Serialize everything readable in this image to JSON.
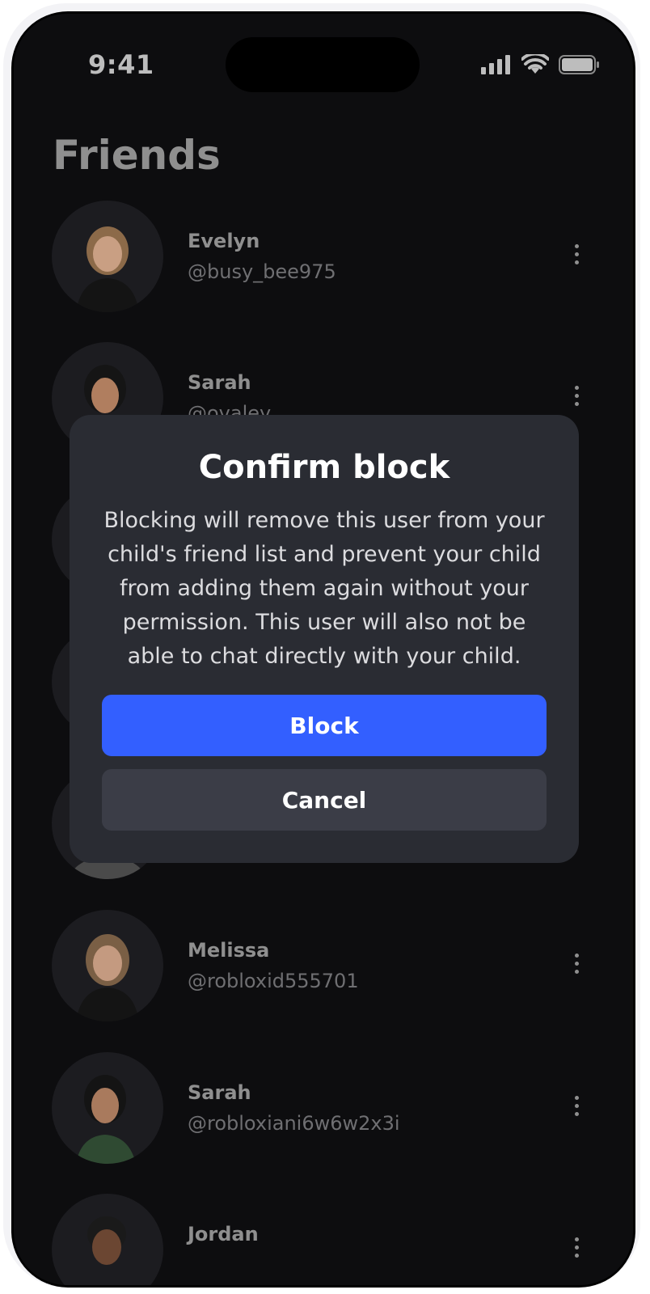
{
  "status_bar": {
    "time": "9:41"
  },
  "page": {
    "title": "Friends"
  },
  "friends": [
    {
      "name": "Evelyn",
      "handle": "@busy_bee975"
    },
    {
      "name": "Sarah",
      "handle": "@ovaley"
    },
    {
      "name": "",
      "handle": ""
    },
    {
      "name": "",
      "handle": ""
    },
    {
      "name": "",
      "handle": ""
    },
    {
      "name": "Melissa",
      "handle": "@robloxid555701"
    },
    {
      "name": "Sarah",
      "handle": "@robloxiani6w6w2x3i"
    },
    {
      "name": "Jordan",
      "handle": ""
    }
  ],
  "dialog": {
    "title": "Confirm block",
    "body": "Blocking will remove this user from your child's friend list and prevent your child from adding them again without your permission. This user will also not be able to chat directly with your child.",
    "primary_label": "Block",
    "secondary_label": "Cancel"
  },
  "colors": {
    "accent": "#335fff",
    "background": "#0d0d0f",
    "dialog": "#2a2c33"
  },
  "icons": [
    "signal-icon",
    "wifi-icon",
    "battery-icon",
    "more-options-icon"
  ]
}
